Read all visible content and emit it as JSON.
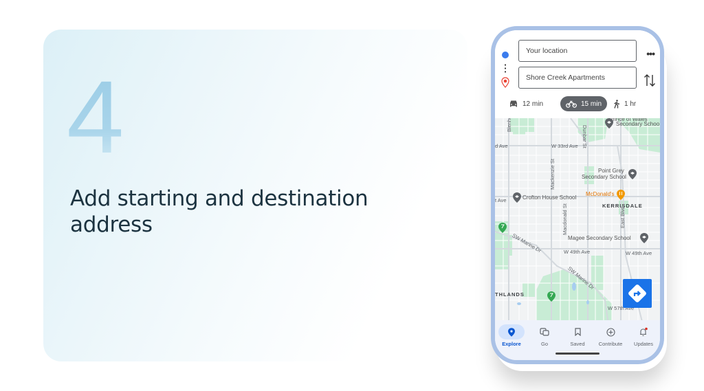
{
  "card": {
    "step_number": "4",
    "title": "Add starting and destination address"
  },
  "phone": {
    "directions": {
      "start_value": "Your location",
      "end_value": "Shore Creek Apartments",
      "more_label": "•••",
      "modes": [
        {
          "name": "drive",
          "label": "12 min",
          "selected": false
        },
        {
          "name": "motorcycle",
          "label": "15 min",
          "selected": true
        },
        {
          "name": "walk",
          "label": "1 hr",
          "selected": false
        }
      ]
    },
    "map": {
      "labels": {
        "school_prince": "Secondary Schoo",
        "school_prince_top": "Prince of Wales",
        "blenheim": "Blenheim",
        "ave_left": "d Ave",
        "w33": "W 33rd Ave",
        "dunbar": "Dunbar St",
        "mackenzie": "Mackenzie St",
        "point_grey_1": "Point Grey",
        "point_grey_2": "Secondary School",
        "crofton": "Crofton House School",
        "ave_left2": "t Ave",
        "mcdonalds": "McDonald's",
        "kerrisdale": "KERRISDALE",
        "macdonald": "Macdonald St",
        "east_blvd": "East Blvd",
        "magee": "Magee Secondary School",
        "marine1": "SW Marine Dr",
        "w49": "W 49th Ave",
        "w49b": "W 49th Ave",
        "marine2": "SW Marine Dr",
        "thlands": "THLANDS",
        "w57": "W 57th Ave"
      }
    },
    "nav": [
      {
        "label": "Explore",
        "active": true
      },
      {
        "label": "Go",
        "active": false
      },
      {
        "label": "Saved",
        "active": false
      },
      {
        "label": "Contribute",
        "active": false
      },
      {
        "label": "Updates",
        "active": false,
        "has_notification": true
      }
    ],
    "colors": {
      "accent": "#1a73e8",
      "frame": "#a9c1e6",
      "park": "#c8ecd5",
      "food": "#e37400"
    }
  }
}
